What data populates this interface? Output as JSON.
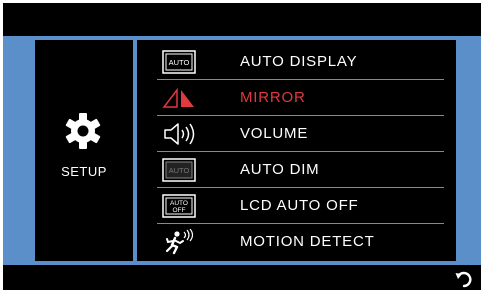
{
  "colors": {
    "band": "#5b8fc9",
    "background": "#000000",
    "text": "#ffffff",
    "highlight": "#e0393e",
    "separator": "#8a8a8a"
  },
  "sidebar": {
    "icon": "gear-icon",
    "label": "SETUP"
  },
  "menu": {
    "items": [
      {
        "label": "AUTO DISPLAY",
        "icon": "auto-badge-icon",
        "icon_text": "AUTO",
        "selected": false
      },
      {
        "label": "MIRROR",
        "icon": "mirror-icon",
        "selected": true
      },
      {
        "label": "VOLUME",
        "icon": "speaker-icon",
        "selected": false
      },
      {
        "label": "AUTO DIM",
        "icon": "auto-dim-icon",
        "icon_text": "AUTO",
        "selected": false
      },
      {
        "label": "LCD AUTO OFF",
        "icon": "auto-off-icon",
        "icon_text_top": "AUTO",
        "icon_text_bottom": "OFF",
        "selected": false
      },
      {
        "label": "MOTION DETECT",
        "icon": "motion-detect-icon",
        "selected": false
      }
    ]
  },
  "footer": {
    "back_icon": "back-arrow-icon"
  }
}
